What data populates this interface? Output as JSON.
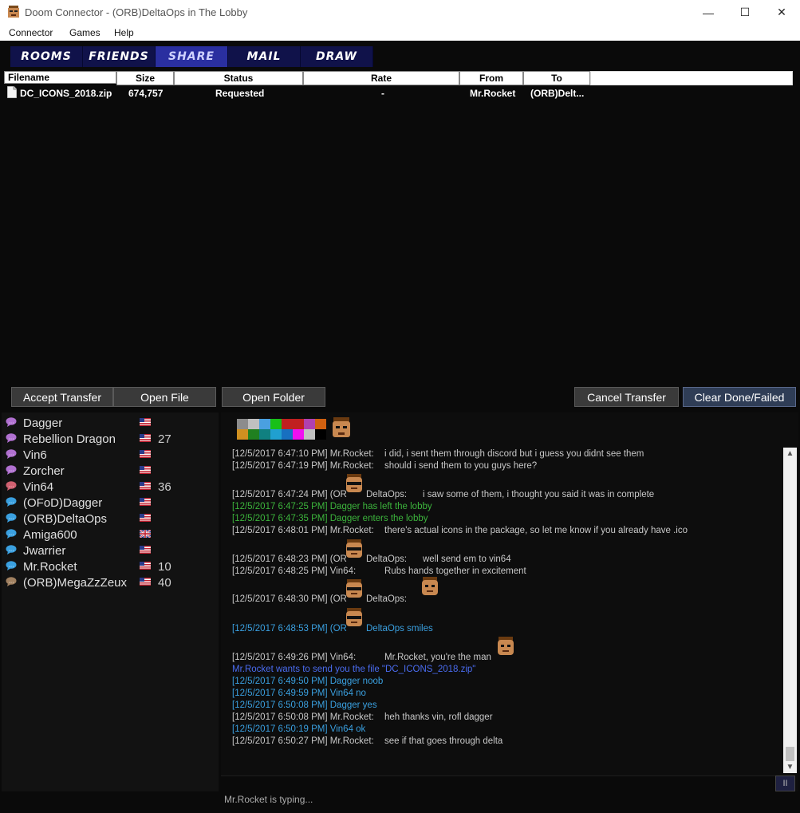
{
  "window": {
    "title": "Doom Connector - (ORB)DeltaOps in The Lobby"
  },
  "menu": [
    "Connector",
    "Games",
    "Help"
  ],
  "nav_tabs": [
    "Rooms",
    "Friends",
    "Share",
    "Mail",
    "Draw"
  ],
  "transfers": {
    "columns": [
      "Filename",
      "Size",
      "Status",
      "Rate",
      "From",
      "To"
    ],
    "rows": [
      {
        "filename": "DC_ICONS_2018.zip",
        "size": "674,757",
        "status": "Requested",
        "rate": "-",
        "from": "Mr.Rocket",
        "to": "(ORB)Delt..."
      }
    ]
  },
  "buttons": {
    "accept": "Accept Transfer",
    "open_file": "Open File",
    "open_folder": "Open Folder",
    "cancel": "Cancel Transfer",
    "clear": "Clear Done/Failed"
  },
  "users": [
    {
      "name": "Dagger",
      "num": "",
      "bubble": "#b070d0",
      "flag": "us"
    },
    {
      "name": "Rebellion Dragon",
      "num": "27",
      "bubble": "#b070d0",
      "flag": "us"
    },
    {
      "name": "Vin6",
      "num": "",
      "bubble": "#b070d0",
      "flag": "us"
    },
    {
      "name": "Zorcher",
      "num": "",
      "bubble": "#b070d0",
      "flag": "us"
    },
    {
      "name": "Vin64",
      "num": "36",
      "bubble": "#d06070",
      "flag": "us"
    },
    {
      "name": "(OFoD)Dagger",
      "num": "",
      "bubble": "#3aa0e0",
      "flag": "us"
    },
    {
      "name": "(ORB)DeltaOps",
      "num": "",
      "bubble": "#3aa0e0",
      "flag": "us"
    },
    {
      "name": "Amiga600",
      "num": "",
      "bubble": "#3aa0e0",
      "flag": "uk"
    },
    {
      "name": "Jwarrier",
      "num": "",
      "bubble": "#3aa0e0",
      "flag": "us"
    },
    {
      "name": "Mr.Rocket",
      "num": "10",
      "bubble": "#3aa0e0",
      "flag": "us"
    },
    {
      "name": "(ORB)MegaZzZeux",
      "num": "40",
      "bubble": "#a08060",
      "flag": "us"
    }
  ],
  "chat": [
    {
      "prefix": "[12/5/2017 6:47:10 PM] Mr.Rocket:",
      "msg": "i did, i sent them through discord but i guess you didnt see them",
      "color": "#c8c8c8"
    },
    {
      "prefix": "[12/5/2017 6:47:19 PM] Mr.Rocket:",
      "msg": "should i send them to you guys here?",
      "color": "#c8c8c8"
    },
    {
      "prefix": "[12/5/2017 6:47:24 PM] (OR",
      "msg": "i saw some of them, i thought you said it was in complete",
      "color": "#c8c8c8",
      "extra": "DeltaOps:"
    },
    {
      "prefix": "[12/5/2017 6:47:25 PM] Dagger has left the lobby",
      "msg": "",
      "color": "#3cb43c"
    },
    {
      "prefix": "[12/5/2017 6:47:35 PM] Dagger enters the lobby",
      "msg": "",
      "color": "#3cb43c"
    },
    {
      "prefix": "[12/5/2017 6:48:01 PM] Mr.Rocket:",
      "msg": "there's actual icons in the package, so let me know if you already have .ico",
      "color": "#c8c8c8"
    },
    {
      "prefix": "[12/5/2017 6:48:23 PM] (OR",
      "msg": "well send em to vin64",
      "color": "#c8c8c8",
      "extra": "DeltaOps:"
    },
    {
      "prefix": "[12/5/2017 6:48:25 PM] Vin64:",
      "msg": "Rubs hands together in excitement",
      "color": "#c8c8c8"
    },
    {
      "prefix": "[12/5/2017 6:48:30 PM] (OR",
      "msg": "",
      "color": "#c8c8c8",
      "extra": "DeltaOps:"
    },
    {
      "prefix": "[12/5/2017 6:48:53 PM] (OR",
      "msg": "",
      "color": "#3aa0e0",
      "extra": "DeltaOps smiles"
    },
    {
      "prefix": "[12/5/2017 6:49:26 PM] Vin64:",
      "msg": "Mr.Rocket, you're the man",
      "color": "#c8c8c8"
    },
    {
      "prefix": "Mr.Rocket wants to send you the file \"DC_ICONS_2018.zip\"",
      "msg": "",
      "color": "#4a6cf0"
    },
    {
      "prefix": "[12/5/2017 6:49:50 PM] Dagger noob",
      "msg": "",
      "color": "#3aa0e0"
    },
    {
      "prefix": "[12/5/2017 6:49:59 PM] Vin64 no",
      "msg": "",
      "color": "#3aa0e0"
    },
    {
      "prefix": "[12/5/2017 6:50:08 PM] Dagger yes",
      "msg": "",
      "color": "#3aa0e0"
    },
    {
      "prefix": "[12/5/2017 6:50:08 PM] Mr.Rocket:",
      "msg": "heh thanks vin, rofl dagger",
      "color": "#c8c8c8"
    },
    {
      "prefix": "[12/5/2017 6:50:19 PM] Vin64 ok",
      "msg": "",
      "color": "#3aa0e0"
    },
    {
      "prefix": "[12/5/2017 6:50:27 PM] Mr.Rocket:",
      "msg": "see if that goes through delta",
      "color": "#c8c8c8"
    }
  ],
  "palette_top": [
    "#8c8c8c",
    "#c0c0c0",
    "#4aa0e0",
    "#18c018",
    "#c02020",
    "#c02020",
    "#b040b0",
    "#d06010"
  ],
  "palette_bottom": [
    "#d09020",
    "#208020",
    "#108080",
    "#20a0d0",
    "#1870c0",
    "#f010f0",
    "#c0c0c0",
    "#000000"
  ],
  "status": "Mr.Rocket is typing..."
}
